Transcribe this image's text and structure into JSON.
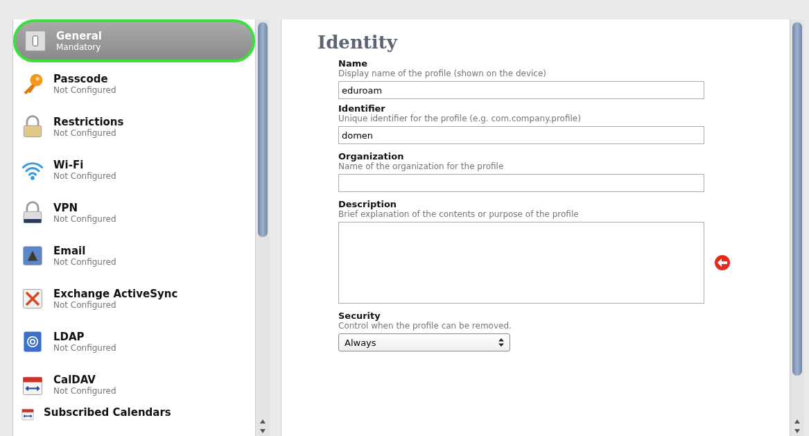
{
  "sidebar": {
    "items": [
      {
        "name": "General",
        "status": "Mandatory",
        "selected": true
      },
      {
        "name": "Passcode",
        "status": "Not Configured",
        "selected": false
      },
      {
        "name": "Restrictions",
        "status": "Not Configured",
        "selected": false
      },
      {
        "name": "Wi-Fi",
        "status": "Not Configured",
        "selected": false
      },
      {
        "name": "VPN",
        "status": "Not Configured",
        "selected": false
      },
      {
        "name": "Email",
        "status": "Not Configured",
        "selected": false
      },
      {
        "name": "Exchange ActiveSync",
        "status": "Not Configured",
        "selected": false
      },
      {
        "name": "LDAP",
        "status": "Not Configured",
        "selected": false
      },
      {
        "name": "CalDAV",
        "status": "Not Configured",
        "selected": false
      },
      {
        "name": "Subscribed Calendars",
        "selected": false
      }
    ]
  },
  "form": {
    "title": "Identity",
    "fields": [
      {
        "kind": "text",
        "label": "Name",
        "hint": "Display name of the profile (shown on the device)",
        "value": "eduroam"
      },
      {
        "kind": "text",
        "label": "Identifier",
        "hint": "Unique identifier for the profile (e.g. com.company.profile)",
        "value": "domen"
      },
      {
        "kind": "text",
        "label": "Organization",
        "hint": "Name of the organization for the profile"
      },
      {
        "kind": "textarea",
        "label": "Description",
        "hint": "Brief explanation of the contents or purpose of the profile",
        "marked": true
      },
      {
        "kind": "select",
        "label": "Security",
        "hint": "Control when the profile can be removed.",
        "value": "Always"
      }
    ]
  }
}
